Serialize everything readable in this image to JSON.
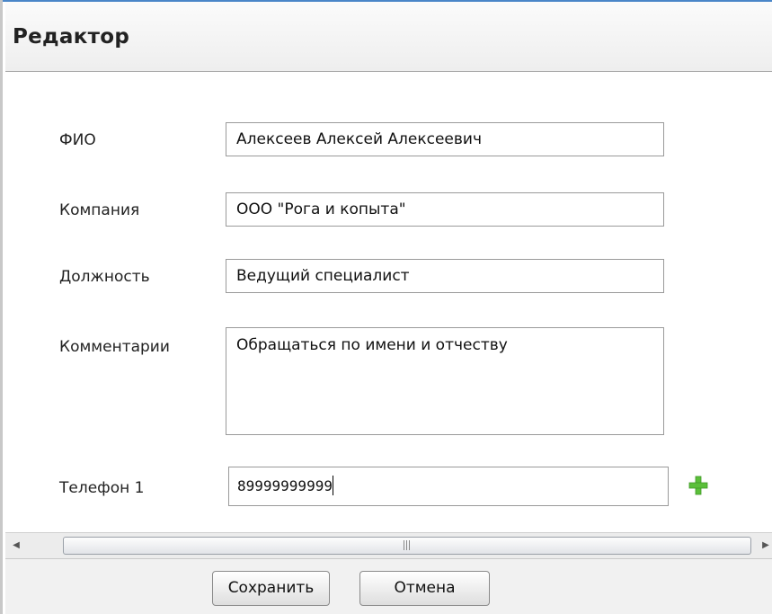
{
  "window": {
    "title": "Редактор"
  },
  "form": {
    "fio": {
      "label": "ФИО",
      "value": "Алексеев Алексей Алексеевич"
    },
    "company": {
      "label": "Компания",
      "value": "ООО \"Рога и копыта\""
    },
    "position": {
      "label": "Должность",
      "value": "Ведущий специалист"
    },
    "comments": {
      "label": "Комментарии",
      "value": "Обращаться по имени и отчеству"
    },
    "phone1": {
      "label": "Телефон 1",
      "value": "89999999999"
    }
  },
  "icons": {
    "add_phone": "plus-icon",
    "add_phone_color": "#5bbf3a"
  },
  "scrollbar": {
    "left_arrow": "◀",
    "right_arrow": "▶"
  },
  "buttons": {
    "save": "Сохранить",
    "cancel": "Отмена"
  }
}
